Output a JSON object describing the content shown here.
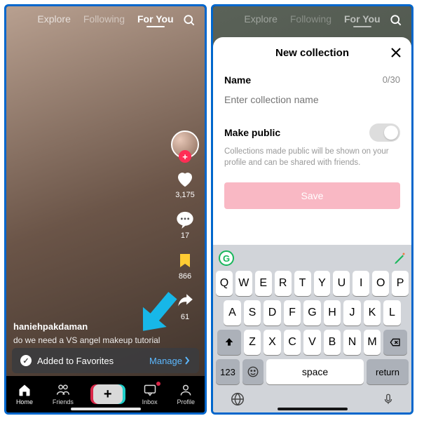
{
  "left": {
    "tabs": {
      "explore": "Explore",
      "following": "Following",
      "foryou": "For You"
    },
    "actions": {
      "likes": "3,175",
      "comments": "17",
      "favorites": "866",
      "shares": "61"
    },
    "caption": {
      "username": "haniehpakdaman",
      "text": "do we need a VS angel makeup tutorial"
    },
    "toast": {
      "message": "Added to Favorites",
      "action": "Manage"
    },
    "nav": {
      "home": "Home",
      "friends": "Friends",
      "inbox": "Inbox",
      "profile": "Profile"
    }
  },
  "right": {
    "tabs": {
      "explore": "Explore",
      "following": "Following",
      "foryou": "For You"
    },
    "sheet": {
      "title": "New collection",
      "name_label": "Name",
      "counter": "0/30",
      "placeholder": "Enter collection name",
      "public_label": "Make public",
      "helper": "Collections made public will be shown on your profile and can be shared with friends.",
      "save": "Save"
    },
    "keyboard": {
      "row1": [
        "Q",
        "W",
        "E",
        "R",
        "T",
        "Y",
        "U",
        "I",
        "O",
        "P"
      ],
      "row2": [
        "A",
        "S",
        "D",
        "F",
        "G",
        "H",
        "J",
        "K",
        "L"
      ],
      "row3": [
        "Z",
        "X",
        "C",
        "V",
        "B",
        "N",
        "M"
      ],
      "k123": "123",
      "space": "space",
      "return": "return"
    }
  }
}
